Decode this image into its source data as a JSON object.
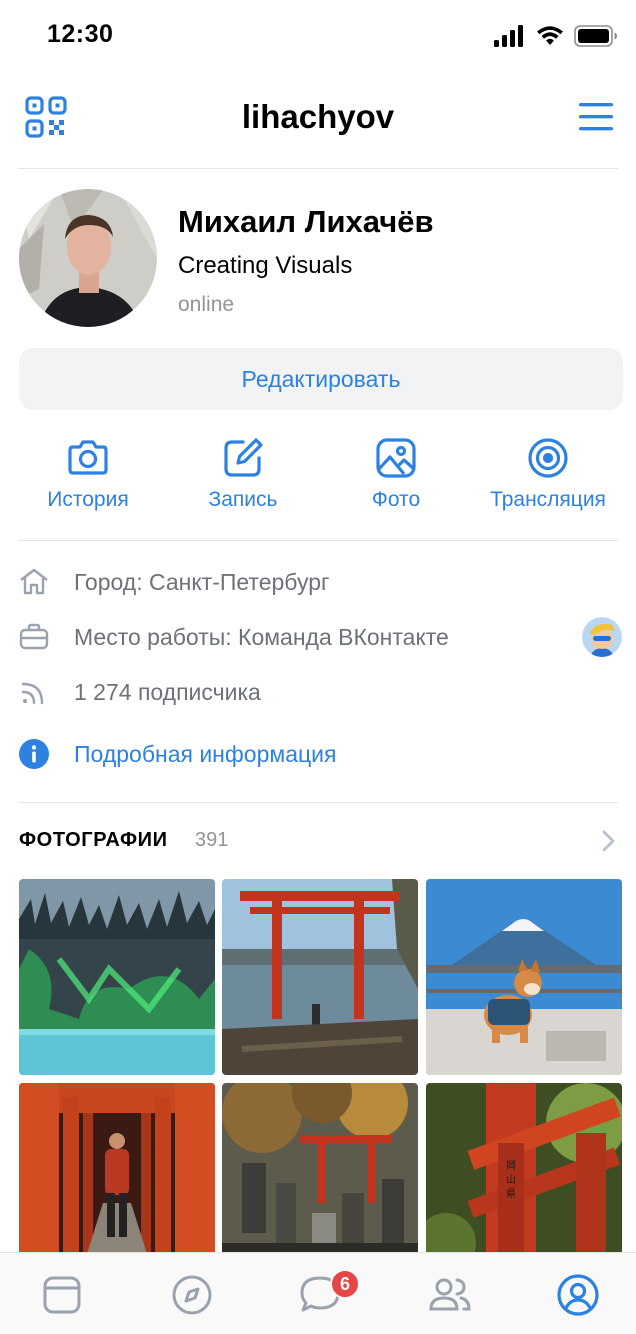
{
  "status_bar": {
    "time": "12:30"
  },
  "header": {
    "username": "lihachyov"
  },
  "profile": {
    "name": "Михаил Лихачёв",
    "status": "Creating Visuals",
    "online": "online",
    "edit_label": "Редактировать"
  },
  "actions": [
    {
      "label": "История",
      "icon": "camera-icon"
    },
    {
      "label": "Запись",
      "icon": "edit-icon"
    },
    {
      "label": "Фото",
      "icon": "photo-icon"
    },
    {
      "label": "Трансляция",
      "icon": "broadcast-icon"
    }
  ],
  "info": {
    "city": "Город: Санкт-Петербург",
    "work": "Место работы: Команда ВКонтакте",
    "followers": "1 274 подписчика",
    "more": "Подробная информация"
  },
  "photos": {
    "title": "ФОТОГРАФИИ",
    "count": "391"
  },
  "tabbar": {
    "messages_badge": "6"
  },
  "colors": {
    "accent": "#2d81e0",
    "secondary_text": "#6d7279",
    "badge": "#e64646"
  }
}
